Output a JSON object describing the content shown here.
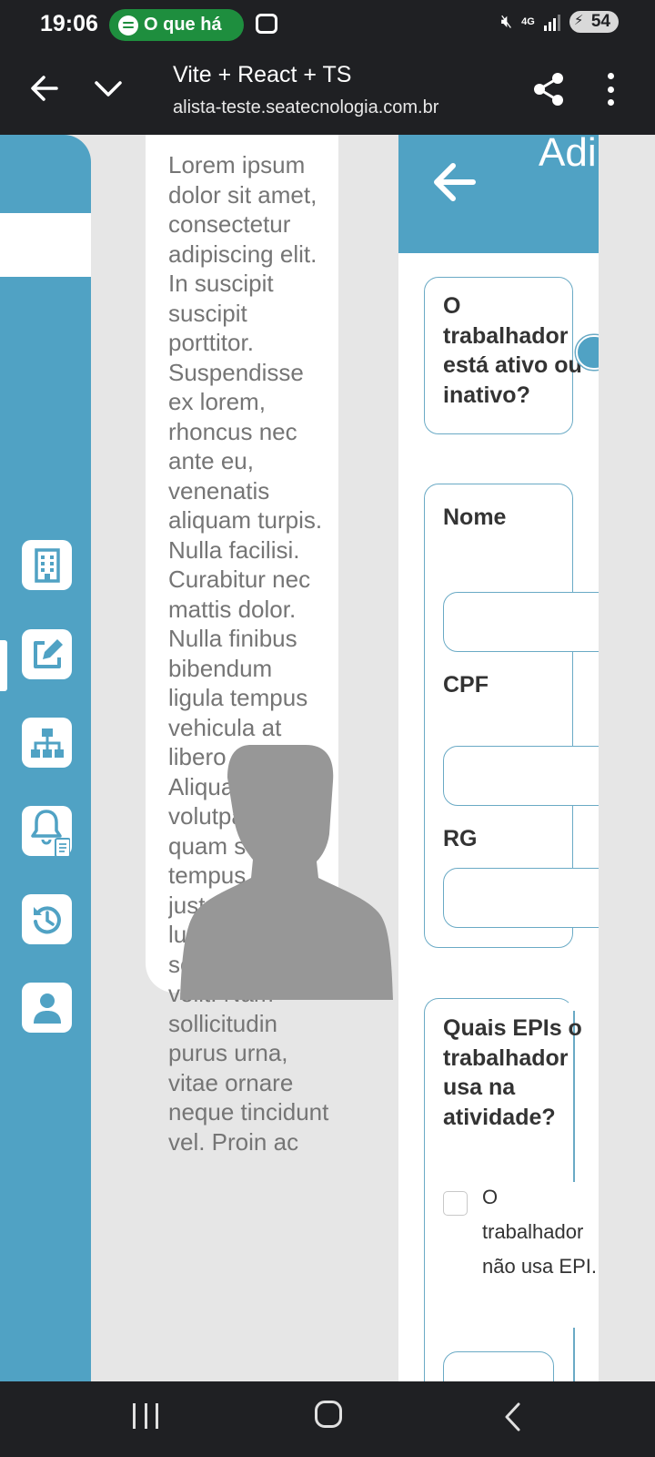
{
  "status_bar": {
    "time": "19:06",
    "media_pill": "O que há",
    "network": "4G",
    "battery": "54",
    "colors": {
      "background": "#1f2023",
      "pill": "#1e8e3e"
    }
  },
  "browser": {
    "title": "Vite + React + TS",
    "url": "alista-teste.seatecnologia.com.br",
    "icons": [
      "back-arrow-icon",
      "chevron-down-icon",
      "share-icon",
      "more-vert-icon"
    ]
  },
  "sidebar": {
    "items": [
      {
        "name": "building-icon",
        "active": false
      },
      {
        "name": "edit-icon",
        "active": true
      },
      {
        "name": "org-chart-icon",
        "active": false
      },
      {
        "name": "bell-document-icon",
        "active": false
      },
      {
        "name": "history-icon",
        "active": false
      },
      {
        "name": "user-icon",
        "active": false
      }
    ],
    "color": "#50a2c4"
  },
  "middle": {
    "lorem": "Lorem ipsum dolor sit amet, consectetur adipiscing elit. In suscipit suscipit porttitor. Suspendisse ex lorem, rhoncus nec ante eu, venenatis aliquam turpis. Nulla facilisi. Curabitur nec mattis dolor. Nulla finibus bibendum ligula tempus vehicula at libero e Aliquam erat volutpat. Fusce quam sem, tempus nec justo eget, luctus scelerisque velit. Nam sollicitudin purus urna, vitae ornare neque tincidunt vel. Proin ac"
  },
  "form": {
    "header_title": "Adi Fun",
    "status_question": "O trabalhador está ativo ou inativo?",
    "fields": {
      "nome": "Nome",
      "cpf": "CPF",
      "rg": "RG"
    },
    "epi_question": "Quais EPIs o trabalhador usa na atividade?",
    "no_epi_checkbox": "O trabalhador não usa EPI.",
    "no_epi_checked": false,
    "accent": "#50a2c4"
  },
  "nav_bar": {
    "icons": [
      "recent-apps-icon",
      "home-icon",
      "back-icon"
    ]
  }
}
